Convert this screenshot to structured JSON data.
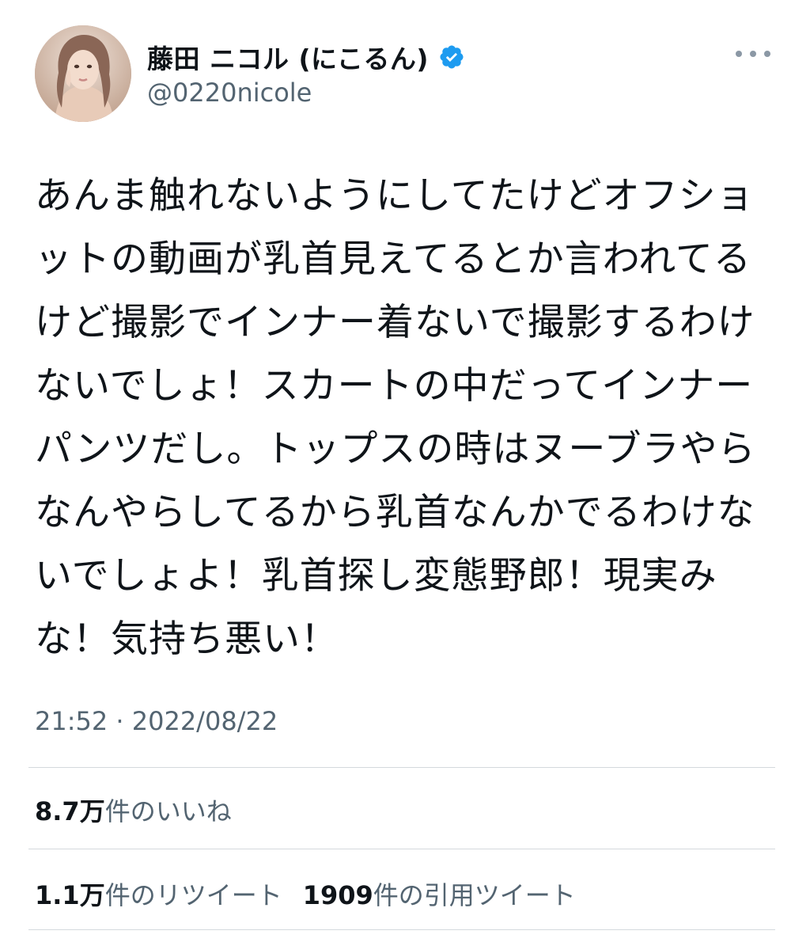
{
  "author": {
    "display_name": "藤田 ニコル (にこるん)",
    "handle": "@0220nicole",
    "verified_icon": "verified-badge-icon",
    "accent_color": "#1d9bf0"
  },
  "tweet": {
    "text": "あんま触れないようにしてたけどオフショットの動画が乳首見えてるとか言われてるけど撮影でインナー着ないで撮影するわけないでしょ！スカートの中だってインナーパンツだし。トップスの時はヌーブラやらなんやらしてるから乳首なんかでるわけないでしょよ！乳首探し変態野郎！現実みな！気持ち悪い！",
    "timestamp": "21:52 · 2022/08/22"
  },
  "stats": {
    "likes_count": "8.7万",
    "likes_label": "件のいいね",
    "retweets_count": "1.1万",
    "retweets_label": "件のリツイート",
    "quotes_count": "1909",
    "quotes_label": "件の引用ツイート"
  },
  "icons": {
    "more": "more-options-icon"
  }
}
